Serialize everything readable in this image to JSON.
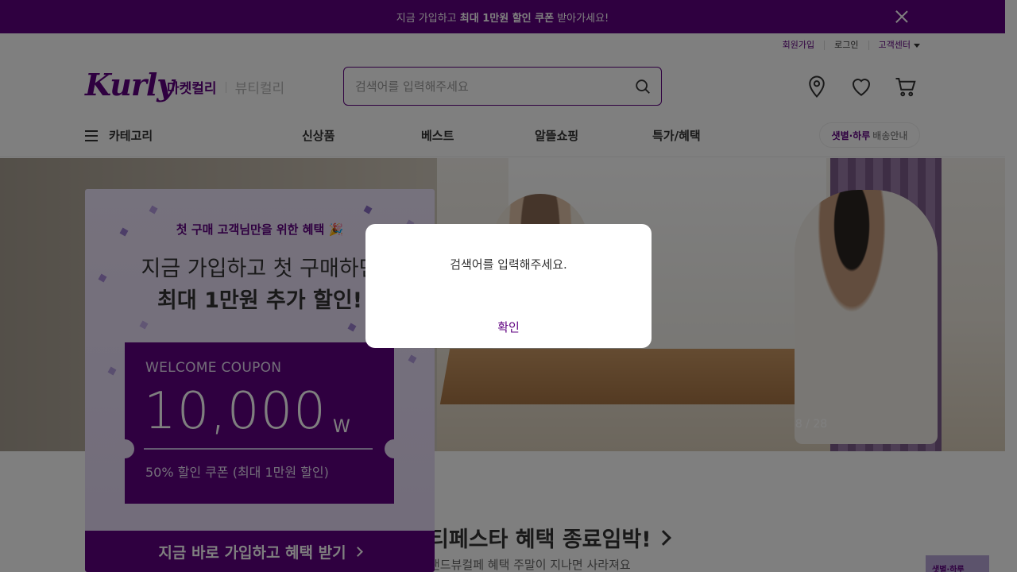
{
  "promo": {
    "text_pre": "지금 가입하고 ",
    "text_bold": "최대 1만원 할인 쿠폰",
    "text_post": " 받아가세요!"
  },
  "util": {
    "signup": "회원가입",
    "login": "로그인",
    "support": "고객센터"
  },
  "logo": {
    "text": "Kurly"
  },
  "tabs": {
    "market": "마켓컬리",
    "beauty": "뷰티컬리"
  },
  "search": {
    "placeholder": "검색어를 입력해주세요"
  },
  "gnb": {
    "category": "카테고리",
    "menu": [
      "신상품",
      "베스트",
      "알뜰쇼핑",
      "특가/혜택"
    ],
    "delivery_bold": "샛별·하루",
    "delivery": "배송안내"
  },
  "hero": {
    "counter": "8 / 28"
  },
  "section": {
    "title": "티페스타 혜택 종료임박!",
    "subtitle": "랜드뷰컬페 혜택 주말이 지나면 사라져요",
    "thumb": "샛별·하루"
  },
  "coupon": {
    "headline": "첫 구매 고객님만을 위한 혜택 🎉",
    "line1": "지금 가입하고 첫 구매하면",
    "line2": "최대 1만원 추가 할인!",
    "ticket_title": "WELCOME COUPON",
    "ticket_amount": "10,000",
    "ticket_currency": "W",
    "ticket_desc": "50% 할인 쿠폰 (최대 1만원 할인)",
    "cta": "지금 바로 가입하고 혜택 받기"
  },
  "modal": {
    "message": "검색어를 입력해주세요.",
    "confirm": "확인"
  },
  "colors": {
    "brand": "#5f0080"
  }
}
